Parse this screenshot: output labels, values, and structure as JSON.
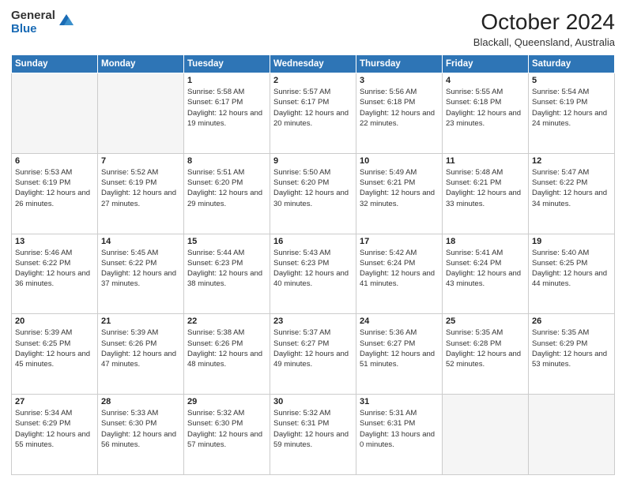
{
  "header": {
    "logo_general": "General",
    "logo_blue": "Blue",
    "month_title": "October 2024",
    "location": "Blackall, Queensland, Australia"
  },
  "days_of_week": [
    "Sunday",
    "Monday",
    "Tuesday",
    "Wednesday",
    "Thursday",
    "Friday",
    "Saturday"
  ],
  "weeks": [
    [
      {
        "day": "",
        "info": ""
      },
      {
        "day": "",
        "info": ""
      },
      {
        "day": "1",
        "info": "Sunrise: 5:58 AM\nSunset: 6:17 PM\nDaylight: 12 hours and 19 minutes."
      },
      {
        "day": "2",
        "info": "Sunrise: 5:57 AM\nSunset: 6:17 PM\nDaylight: 12 hours and 20 minutes."
      },
      {
        "day": "3",
        "info": "Sunrise: 5:56 AM\nSunset: 6:18 PM\nDaylight: 12 hours and 22 minutes."
      },
      {
        "day": "4",
        "info": "Sunrise: 5:55 AM\nSunset: 6:18 PM\nDaylight: 12 hours and 23 minutes."
      },
      {
        "day": "5",
        "info": "Sunrise: 5:54 AM\nSunset: 6:19 PM\nDaylight: 12 hours and 24 minutes."
      }
    ],
    [
      {
        "day": "6",
        "info": "Sunrise: 5:53 AM\nSunset: 6:19 PM\nDaylight: 12 hours and 26 minutes."
      },
      {
        "day": "7",
        "info": "Sunrise: 5:52 AM\nSunset: 6:19 PM\nDaylight: 12 hours and 27 minutes."
      },
      {
        "day": "8",
        "info": "Sunrise: 5:51 AM\nSunset: 6:20 PM\nDaylight: 12 hours and 29 minutes."
      },
      {
        "day": "9",
        "info": "Sunrise: 5:50 AM\nSunset: 6:20 PM\nDaylight: 12 hours and 30 minutes."
      },
      {
        "day": "10",
        "info": "Sunrise: 5:49 AM\nSunset: 6:21 PM\nDaylight: 12 hours and 32 minutes."
      },
      {
        "day": "11",
        "info": "Sunrise: 5:48 AM\nSunset: 6:21 PM\nDaylight: 12 hours and 33 minutes."
      },
      {
        "day": "12",
        "info": "Sunrise: 5:47 AM\nSunset: 6:22 PM\nDaylight: 12 hours and 34 minutes."
      }
    ],
    [
      {
        "day": "13",
        "info": "Sunrise: 5:46 AM\nSunset: 6:22 PM\nDaylight: 12 hours and 36 minutes."
      },
      {
        "day": "14",
        "info": "Sunrise: 5:45 AM\nSunset: 6:22 PM\nDaylight: 12 hours and 37 minutes."
      },
      {
        "day": "15",
        "info": "Sunrise: 5:44 AM\nSunset: 6:23 PM\nDaylight: 12 hours and 38 minutes."
      },
      {
        "day": "16",
        "info": "Sunrise: 5:43 AM\nSunset: 6:23 PM\nDaylight: 12 hours and 40 minutes."
      },
      {
        "day": "17",
        "info": "Sunrise: 5:42 AM\nSunset: 6:24 PM\nDaylight: 12 hours and 41 minutes."
      },
      {
        "day": "18",
        "info": "Sunrise: 5:41 AM\nSunset: 6:24 PM\nDaylight: 12 hours and 43 minutes."
      },
      {
        "day": "19",
        "info": "Sunrise: 5:40 AM\nSunset: 6:25 PM\nDaylight: 12 hours and 44 minutes."
      }
    ],
    [
      {
        "day": "20",
        "info": "Sunrise: 5:39 AM\nSunset: 6:25 PM\nDaylight: 12 hours and 45 minutes."
      },
      {
        "day": "21",
        "info": "Sunrise: 5:39 AM\nSunset: 6:26 PM\nDaylight: 12 hours and 47 minutes."
      },
      {
        "day": "22",
        "info": "Sunrise: 5:38 AM\nSunset: 6:26 PM\nDaylight: 12 hours and 48 minutes."
      },
      {
        "day": "23",
        "info": "Sunrise: 5:37 AM\nSunset: 6:27 PM\nDaylight: 12 hours and 49 minutes."
      },
      {
        "day": "24",
        "info": "Sunrise: 5:36 AM\nSunset: 6:27 PM\nDaylight: 12 hours and 51 minutes."
      },
      {
        "day": "25",
        "info": "Sunrise: 5:35 AM\nSunset: 6:28 PM\nDaylight: 12 hours and 52 minutes."
      },
      {
        "day": "26",
        "info": "Sunrise: 5:35 AM\nSunset: 6:29 PM\nDaylight: 12 hours and 53 minutes."
      }
    ],
    [
      {
        "day": "27",
        "info": "Sunrise: 5:34 AM\nSunset: 6:29 PM\nDaylight: 12 hours and 55 minutes."
      },
      {
        "day": "28",
        "info": "Sunrise: 5:33 AM\nSunset: 6:30 PM\nDaylight: 12 hours and 56 minutes."
      },
      {
        "day": "29",
        "info": "Sunrise: 5:32 AM\nSunset: 6:30 PM\nDaylight: 12 hours and 57 minutes."
      },
      {
        "day": "30",
        "info": "Sunrise: 5:32 AM\nSunset: 6:31 PM\nDaylight: 12 hours and 59 minutes."
      },
      {
        "day": "31",
        "info": "Sunrise: 5:31 AM\nSunset: 6:31 PM\nDaylight: 13 hours and 0 minutes."
      },
      {
        "day": "",
        "info": ""
      },
      {
        "day": "",
        "info": ""
      }
    ]
  ]
}
